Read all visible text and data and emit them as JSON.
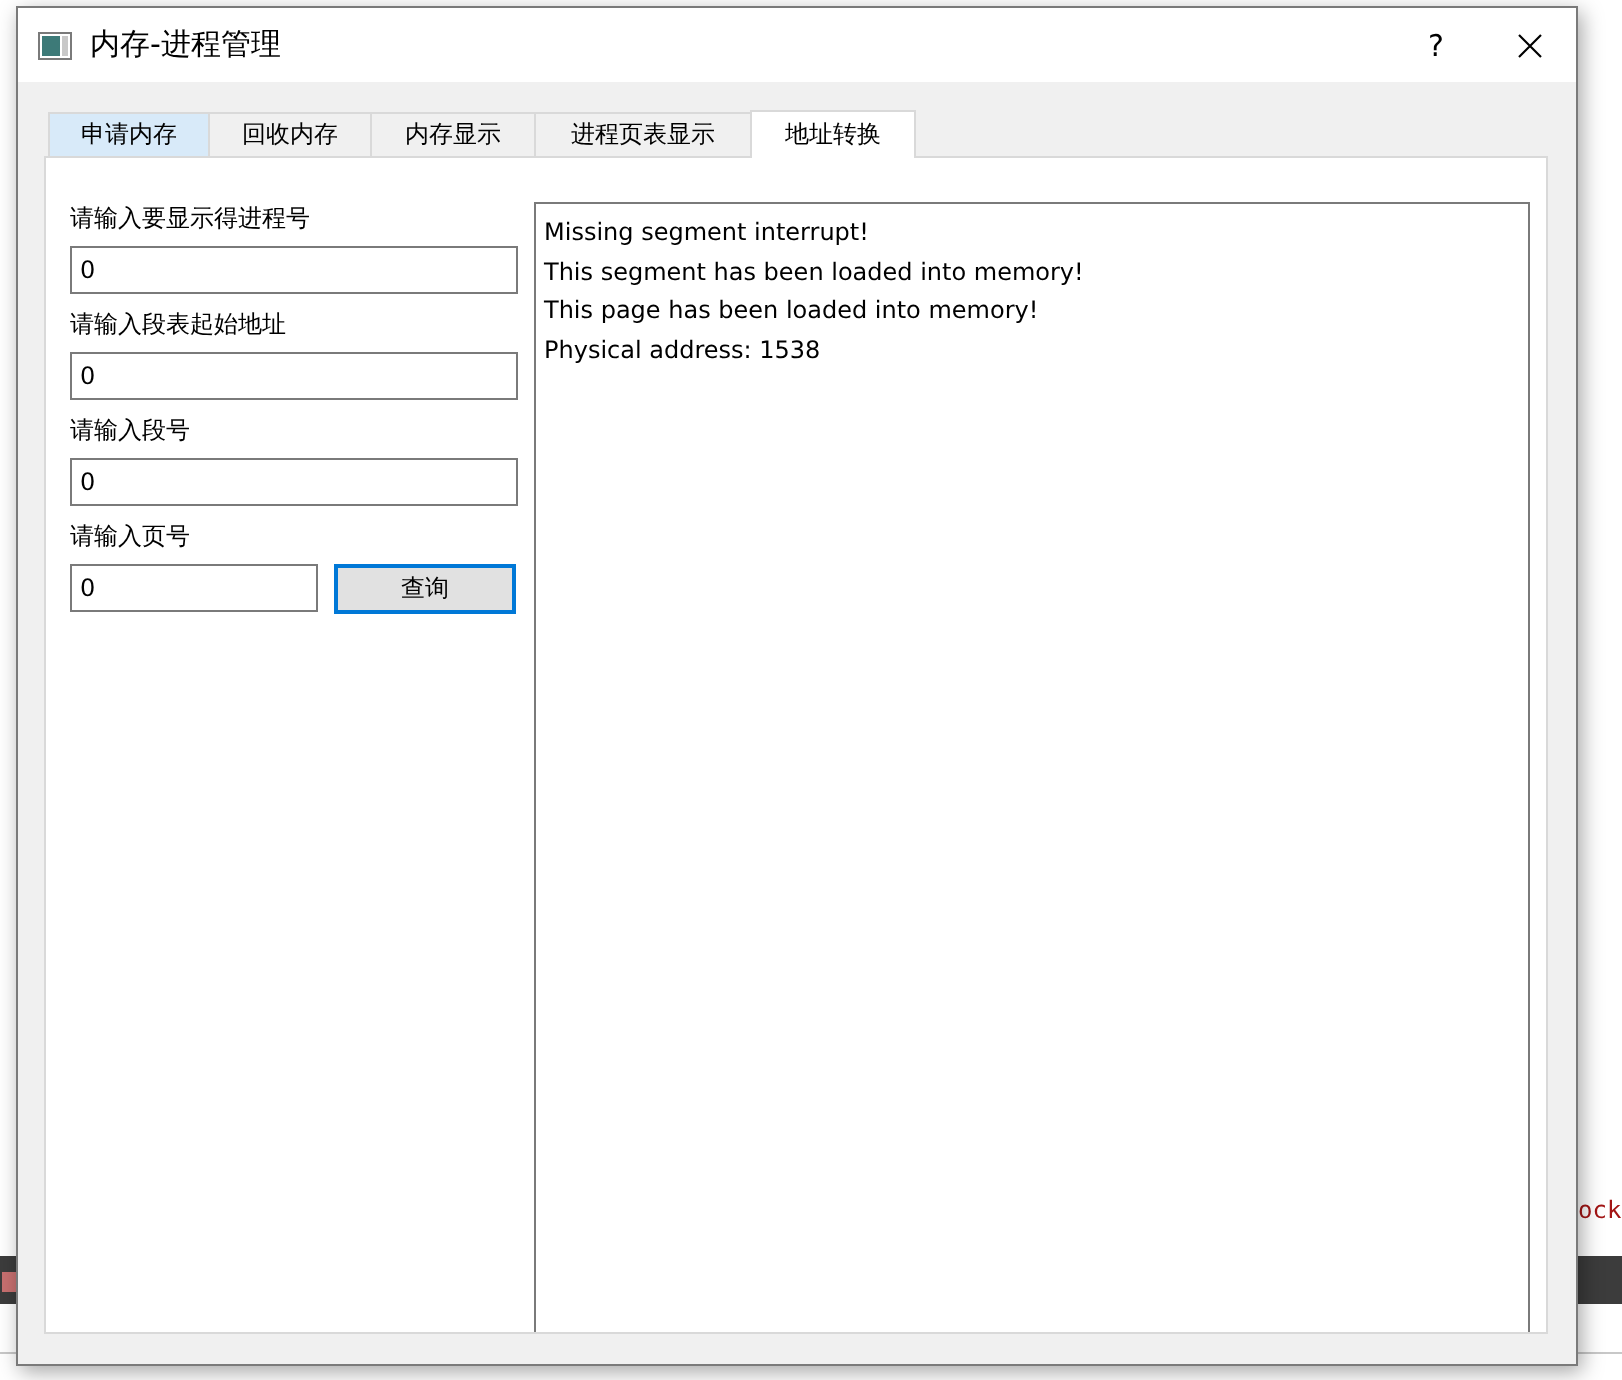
{
  "background_editor": {
    "fragment": "ock"
  },
  "window": {
    "title": "内存-进程管理",
    "help_button": "?"
  },
  "tabs": [
    {
      "label": "申请内存",
      "selected": false,
      "highlighted": true
    },
    {
      "label": "回收内存",
      "selected": false,
      "highlighted": false
    },
    {
      "label": "内存显示",
      "selected": false,
      "highlighted": false
    },
    {
      "label": "进程页表显示",
      "selected": false,
      "highlighted": false
    },
    {
      "label": "地址转换",
      "selected": true,
      "highlighted": false
    }
  ],
  "form": {
    "fields": [
      {
        "label": "请输入要显示得进程号",
        "value": "0"
      },
      {
        "label": "请输入段表起始地址",
        "value": "0"
      },
      {
        "label": "请输入段号",
        "value": "0"
      },
      {
        "label": "请输入页号",
        "value": "0"
      }
    ],
    "query_button": "查询"
  },
  "output": {
    "lines": [
      "Missing segment interrupt!",
      "This segment has been loaded into memory!",
      "This page has been loaded into memory!",
      "Physical address: 1538"
    ]
  }
}
